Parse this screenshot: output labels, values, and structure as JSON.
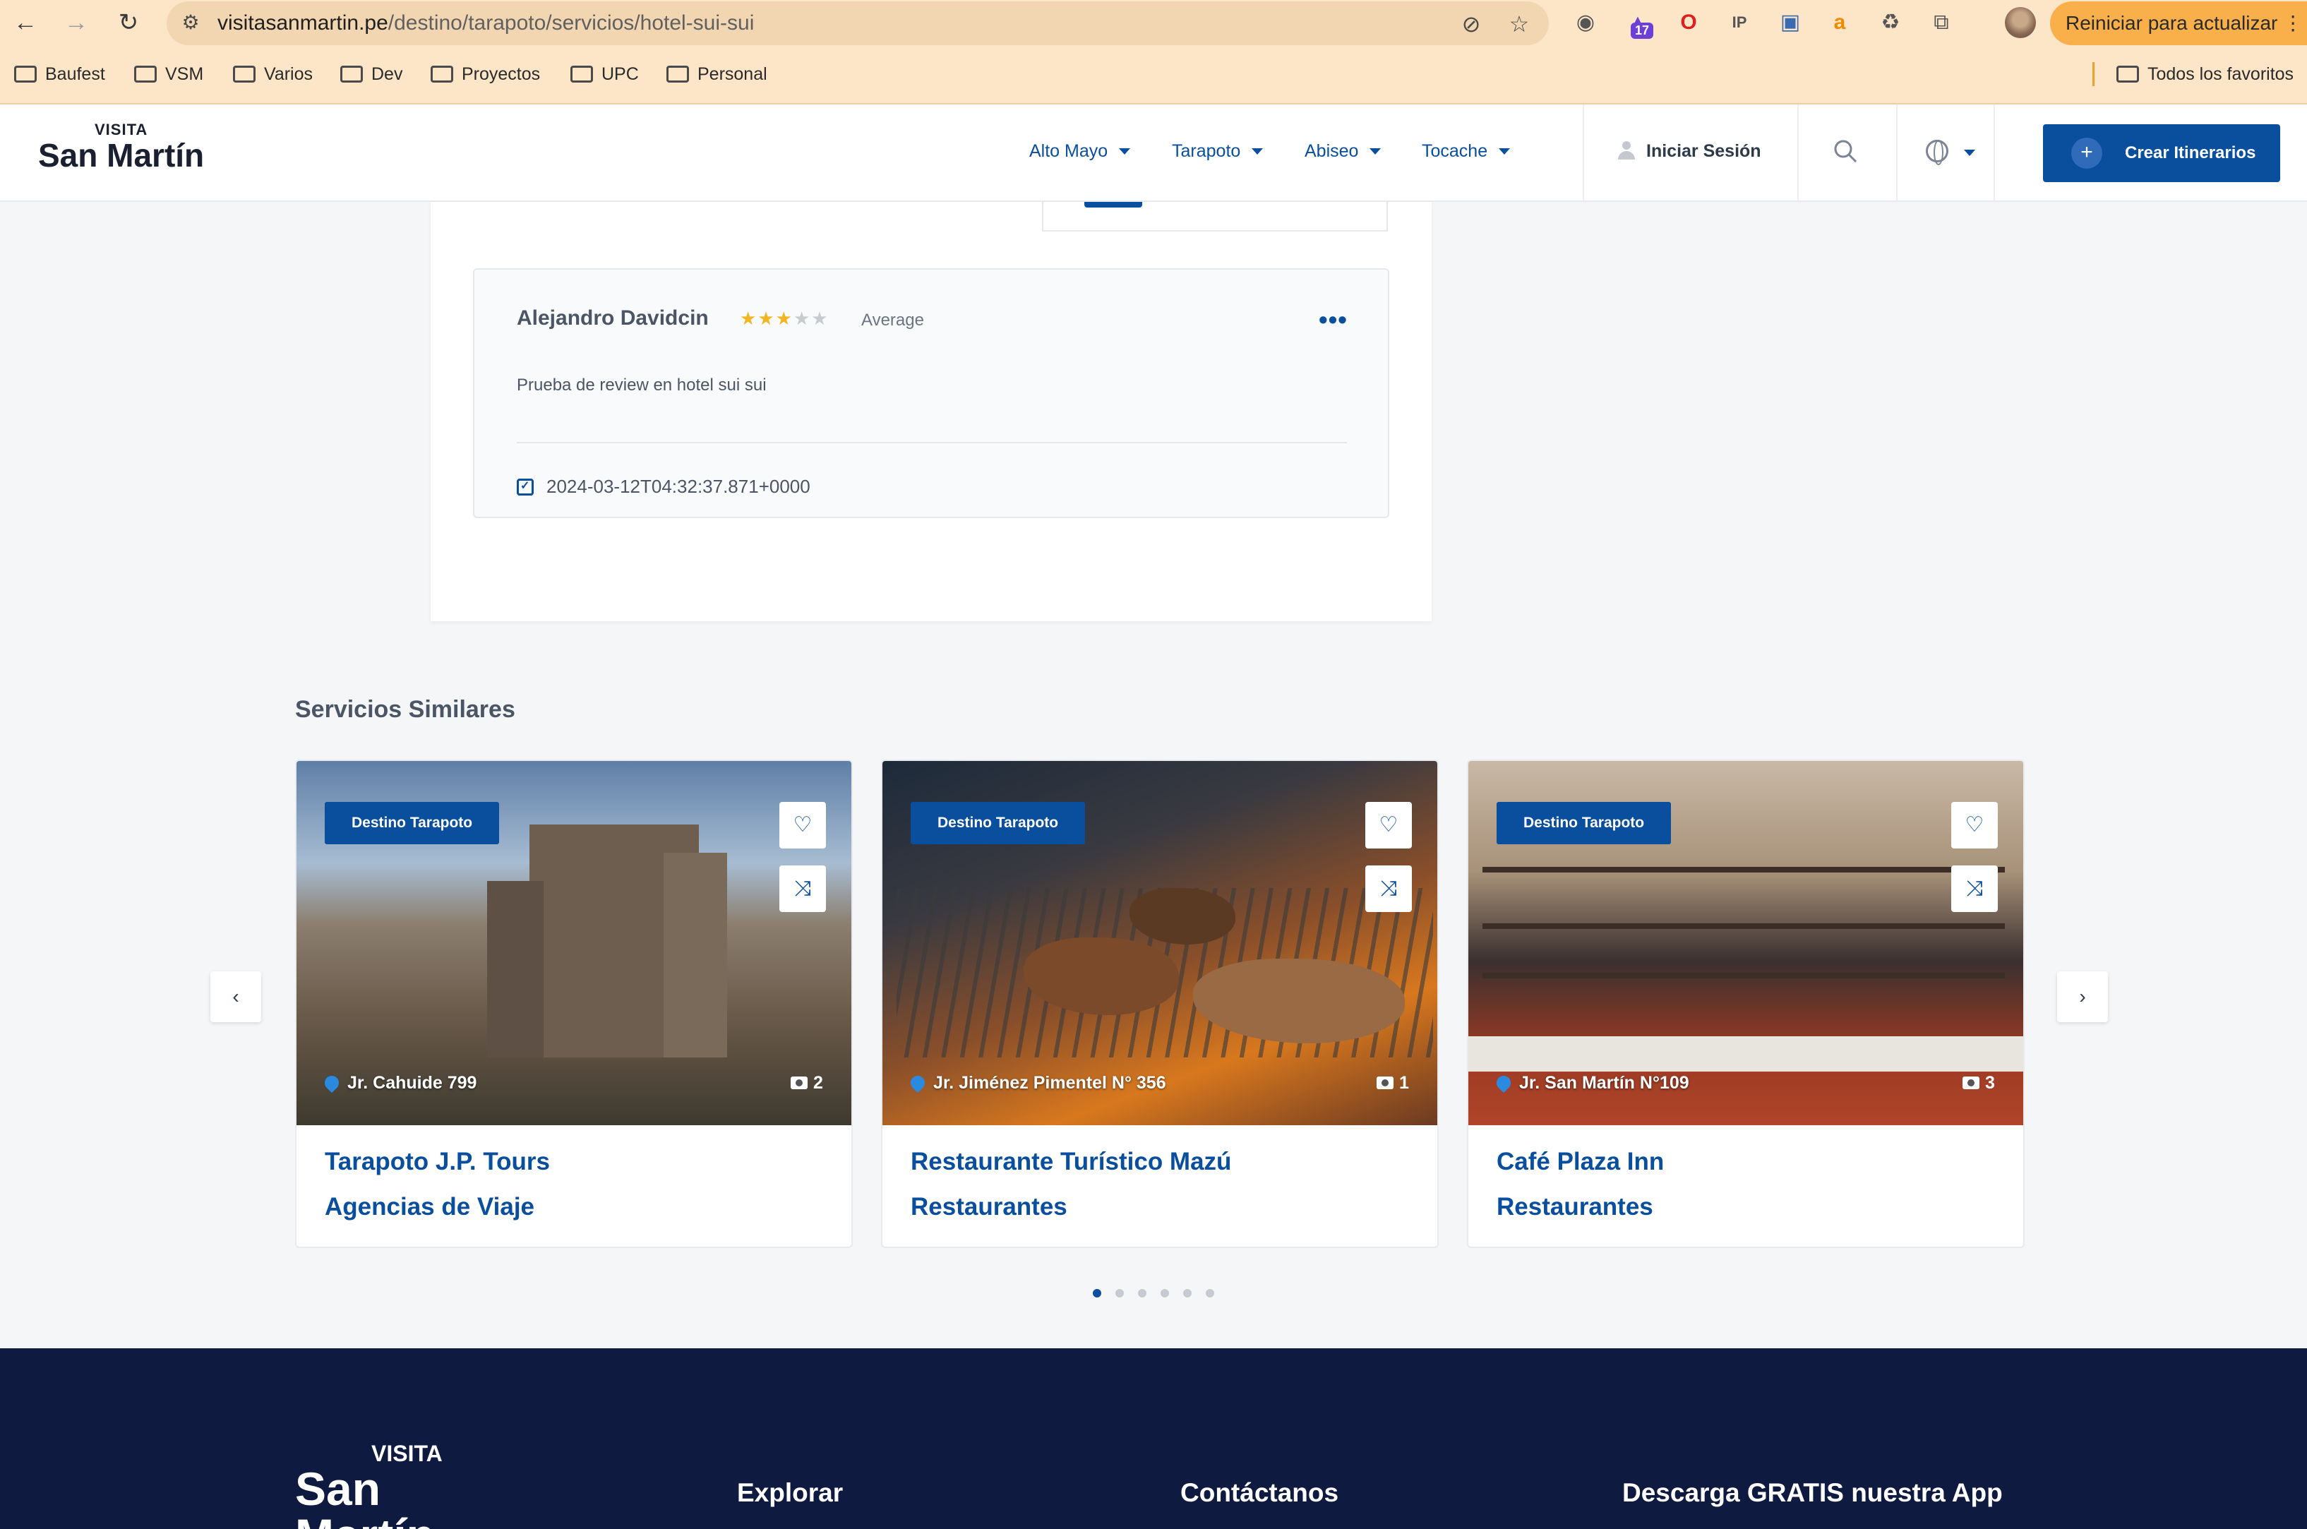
{
  "browser": {
    "url_host": "visitasanmartin.pe",
    "url_path": "/destino/tarapoto/servicios/hotel-sui-sui",
    "extension_badge": "17",
    "update_label": "Reiniciar para actualizar",
    "bookmarks": [
      "Baufest",
      "VSM",
      "Varios",
      "Dev",
      "Proyectos",
      "UPC",
      "Personal"
    ],
    "all_bookmarks": "Todos los favoritos"
  },
  "header": {
    "logo_small": "VISITA",
    "logo_big": "San Martín",
    "nav": [
      "Alto Mayo",
      "Tarapoto",
      "Abiseo",
      "Tocache"
    ],
    "login": "Iniciar Sesión",
    "cta": "Crear Itinerarios"
  },
  "review": {
    "author": "Alejandro Davidcin",
    "rating": 3,
    "rating_max": 5,
    "rating_label": "Average",
    "text": "Prueba de review en hotel sui sui",
    "date": "2024-03-12T04:32:37.871+0000"
  },
  "similar": {
    "title": "Servicios Similares",
    "cards": [
      {
        "tag": "Destino Tarapoto",
        "address": "Jr. Cahuide 799",
        "photos": "2",
        "name": "Tarapoto J.P. Tours",
        "category": "Agencias de Viaje"
      },
      {
        "tag": "Destino Tarapoto",
        "address": "Jr. Jiménez Pimentel N° 356",
        "photos": "1",
        "name": "Restaurante Turístico Mazú",
        "category": "Restaurantes"
      },
      {
        "tag": "Destino Tarapoto",
        "address": "Jr. San Martín N°109",
        "photos": "3",
        "name": "Café Plaza Inn",
        "category": "Restaurantes"
      }
    ],
    "page_count": 6,
    "active_page": 1
  },
  "footer": {
    "logo_small": "VISITA",
    "logo_big": "San Martín",
    "columns": [
      "Explorar",
      "Contáctanos",
      "Descarga GRATIS nuestra App"
    ]
  },
  "colors": {
    "brand": "#0a4e9e",
    "footer_bg": "#0e1a3f",
    "star": "#f3b623",
    "chrome": "#fde6c8"
  }
}
